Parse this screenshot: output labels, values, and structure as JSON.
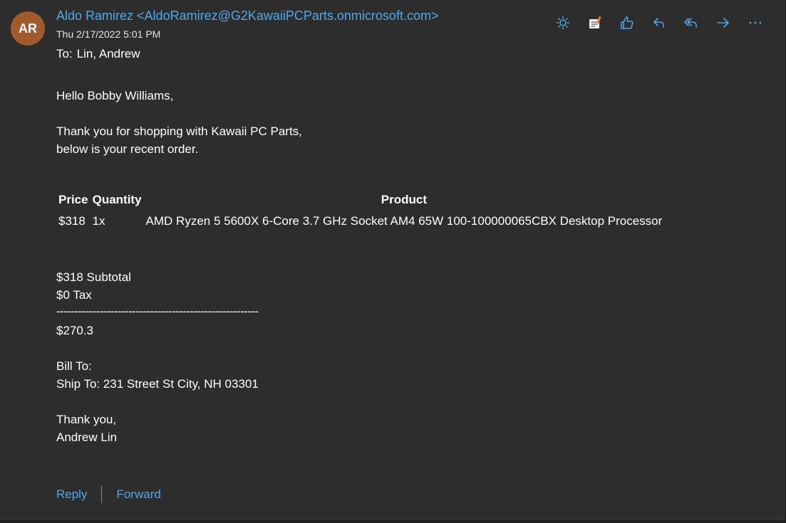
{
  "message": {
    "avatar_initials": "AR",
    "sender": "Aldo Ramirez <AldoRamirez@G2KawaiiPCParts.onmicrosoft.com>",
    "date": "Thu 2/17/2022 5:01 PM",
    "to_label": "To:",
    "to_value": "Lin, Andrew"
  },
  "toolbar": {
    "icons": [
      "sun-icon",
      "notes-icon",
      "like-icon",
      "reply-icon",
      "reply-all-icon",
      "forward-icon",
      "more-icon"
    ],
    "accent_color": "#4fa8e8"
  },
  "body": {
    "greeting": "Hello Bobby Williams,",
    "intro_line1": "Thank you for shopping with Kawaii PC Parts,",
    "intro_line2": "below is your recent order.",
    "table": {
      "headers": [
        "Price",
        "Quantity",
        "Product"
      ],
      "rows": [
        {
          "price": "$318",
          "quantity": "1x",
          "product": "AMD Ryzen 5 5600X 6-Core 3.7 GHz Socket AM4 65W 100-100000065CBX Desktop Processor"
        }
      ]
    },
    "subtotal": "$318 Subtotal",
    "tax": "$0 Tax",
    "divider": "--------------------------------------------------------",
    "total": "$270.3",
    "bill_to": "Bill To:",
    "ship_to": "Ship To: 231 Street St City, NH 03301",
    "closing": "Thank you,",
    "signature": "Andrew Lin"
  },
  "footer": {
    "reply_label": "Reply",
    "forward_label": "Forward"
  }
}
